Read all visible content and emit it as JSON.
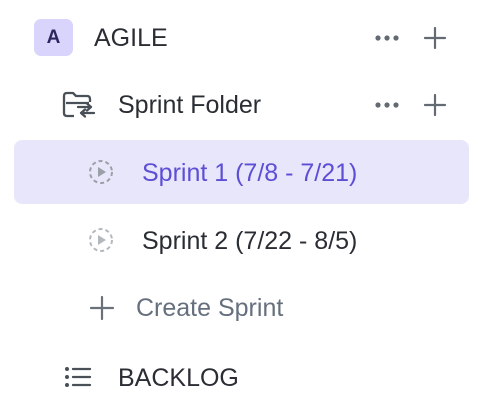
{
  "space": {
    "avatar_letter": "A",
    "name": "AGILE"
  },
  "folder": {
    "name": "Sprint Folder"
  },
  "sprints": [
    {
      "label": "Sprint 1 (7/8 - 7/21)",
      "selected": true
    },
    {
      "label": "Sprint 2 (7/22 - 8/5)",
      "selected": false
    }
  ],
  "create_sprint": {
    "label": "Create Sprint"
  },
  "backlog": {
    "label": "BACKLOG"
  },
  "colors": {
    "accent": "#5d4ed6",
    "selected_bg": "#e7e6fa",
    "avatar_bg": "#d8d4fb",
    "text": "#2a2e34",
    "muted": "#656f7d"
  }
}
